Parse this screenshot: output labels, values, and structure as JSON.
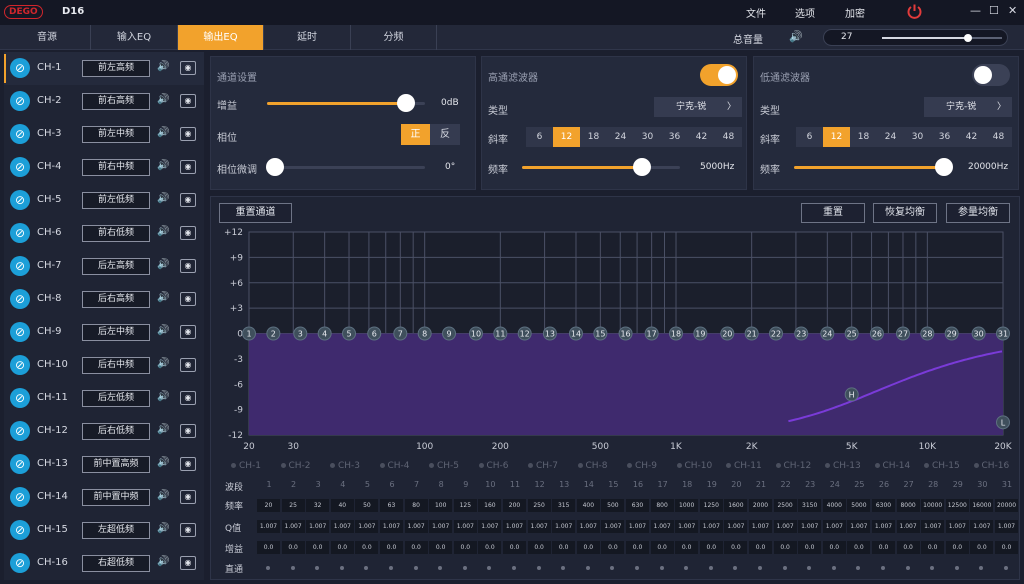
{
  "app": {
    "logo": "DEGO",
    "title": "D16"
  },
  "menu": {
    "file": "文件",
    "options": "选项",
    "encrypt": "加密"
  },
  "window": {
    "min": "—",
    "max": "☐",
    "close": "✕"
  },
  "tabs": [
    {
      "label": "音源"
    },
    {
      "label": "输入EQ"
    },
    {
      "label": "输出EQ",
      "active": true
    },
    {
      "label": "延时"
    },
    {
      "label": "分频"
    }
  ],
  "master": {
    "label": "总音量",
    "value": "27",
    "level": 0.72
  },
  "channels": [
    {
      "id": "CH-1",
      "name": "前左高频",
      "selected": true
    },
    {
      "id": "CH-2",
      "name": "前右高频"
    },
    {
      "id": "CH-3",
      "name": "前左中频"
    },
    {
      "id": "CH-4",
      "name": "前右中频"
    },
    {
      "id": "CH-5",
      "name": "前左低频"
    },
    {
      "id": "CH-6",
      "name": "前右低频"
    },
    {
      "id": "CH-7",
      "name": "后左高频"
    },
    {
      "id": "CH-8",
      "name": "后右高频"
    },
    {
      "id": "CH-9",
      "name": "后左中频"
    },
    {
      "id": "CH-10",
      "name": "后右中频"
    },
    {
      "id": "CH-11",
      "name": "后左低频"
    },
    {
      "id": "CH-12",
      "name": "后右低频"
    },
    {
      "id": "CH-13",
      "name": "前中置高频"
    },
    {
      "id": "CH-14",
      "name": "前中置中频"
    },
    {
      "id": "CH-15",
      "name": "左超低频"
    },
    {
      "id": "CH-16",
      "name": "右超低频"
    }
  ],
  "channel_settings": {
    "title": "通道设置",
    "gain": {
      "label": "增益",
      "value": "0dB",
      "level": 0.88
    },
    "phase": {
      "label": "相位",
      "pos": "正",
      "neg": "反"
    },
    "phase_fine": {
      "label": "相位微调",
      "value": "0°",
      "level": 0.0
    }
  },
  "hpf": {
    "title": "高通滤波器",
    "enabled": true,
    "type_label": "类型",
    "type_value": "宁克-锐",
    "slope_label": "斜率",
    "slopes": [
      "6",
      "12",
      "18",
      "24",
      "30",
      "36",
      "42",
      "48"
    ],
    "slope_selected": "12",
    "freq_label": "频率",
    "freq_value": "5000Hz",
    "level": 0.76
  },
  "lpf": {
    "title": "低通滤波器",
    "enabled": false,
    "type_label": "类型",
    "type_value": "宁克-锐",
    "slope_label": "斜率",
    "slopes": [
      "6",
      "12",
      "18",
      "24",
      "30",
      "36",
      "42",
      "48"
    ],
    "slope_selected": "12",
    "freq_label": "频率",
    "freq_value": "20000Hz",
    "level": 1.0
  },
  "eq_buttons": {
    "reset_channel": "重置通道",
    "reset": "重置",
    "restore": "恢复均衡",
    "param": "参量均衡"
  },
  "eq_axis": {
    "y_ticks": [
      "+12",
      "+9",
      "+6",
      "+3",
      "0",
      "-3",
      "-6",
      "-9",
      "-12"
    ],
    "x_ticks": [
      "20",
      "30",
      "100",
      "200",
      "500",
      "1K",
      "2K",
      "5K",
      "10K",
      "20K"
    ]
  },
  "eq_bands": [
    "1",
    "2",
    "3",
    "4",
    "5",
    "6",
    "7",
    "8",
    "9",
    "10",
    "11",
    "12",
    "13",
    "14",
    "15",
    "16",
    "17",
    "18",
    "19",
    "20",
    "21",
    "22",
    "23",
    "24",
    "25",
    "26",
    "27",
    "28",
    "29",
    "30",
    "31"
  ],
  "eq_markers": {
    "high": "H",
    "low": "L"
  },
  "channel_checks": [
    "CH-1",
    "CH-2",
    "CH-3",
    "CH-4",
    "CH-5",
    "CH-6",
    "CH-7",
    "CH-8",
    "CH-9",
    "CH-10",
    "CH-11",
    "CH-12",
    "CH-13",
    "CH-14",
    "CH-15",
    "CH-16"
  ],
  "table": {
    "band_label": "波段",
    "freq_label": "频率",
    "q_label": "Q值",
    "gain_label": "增益",
    "bypass_label": "直通",
    "freqs": [
      "20",
      "25",
      "32",
      "40",
      "50",
      "63",
      "80",
      "100",
      "125",
      "160",
      "200",
      "250",
      "315",
      "400",
      "500",
      "630",
      "800",
      "1000",
      "1250",
      "1600",
      "2000",
      "2500",
      "3150",
      "4000",
      "5000",
      "6300",
      "8000",
      "10000",
      "12500",
      "16000",
      "20000"
    ],
    "q": "1.007",
    "gain": "0.0"
  },
  "colors": {
    "accent": "#f2a22c",
    "eq_fill": "#3f2a6e",
    "curve": "#7a3bd8",
    "icon": "#1c9fd8"
  }
}
